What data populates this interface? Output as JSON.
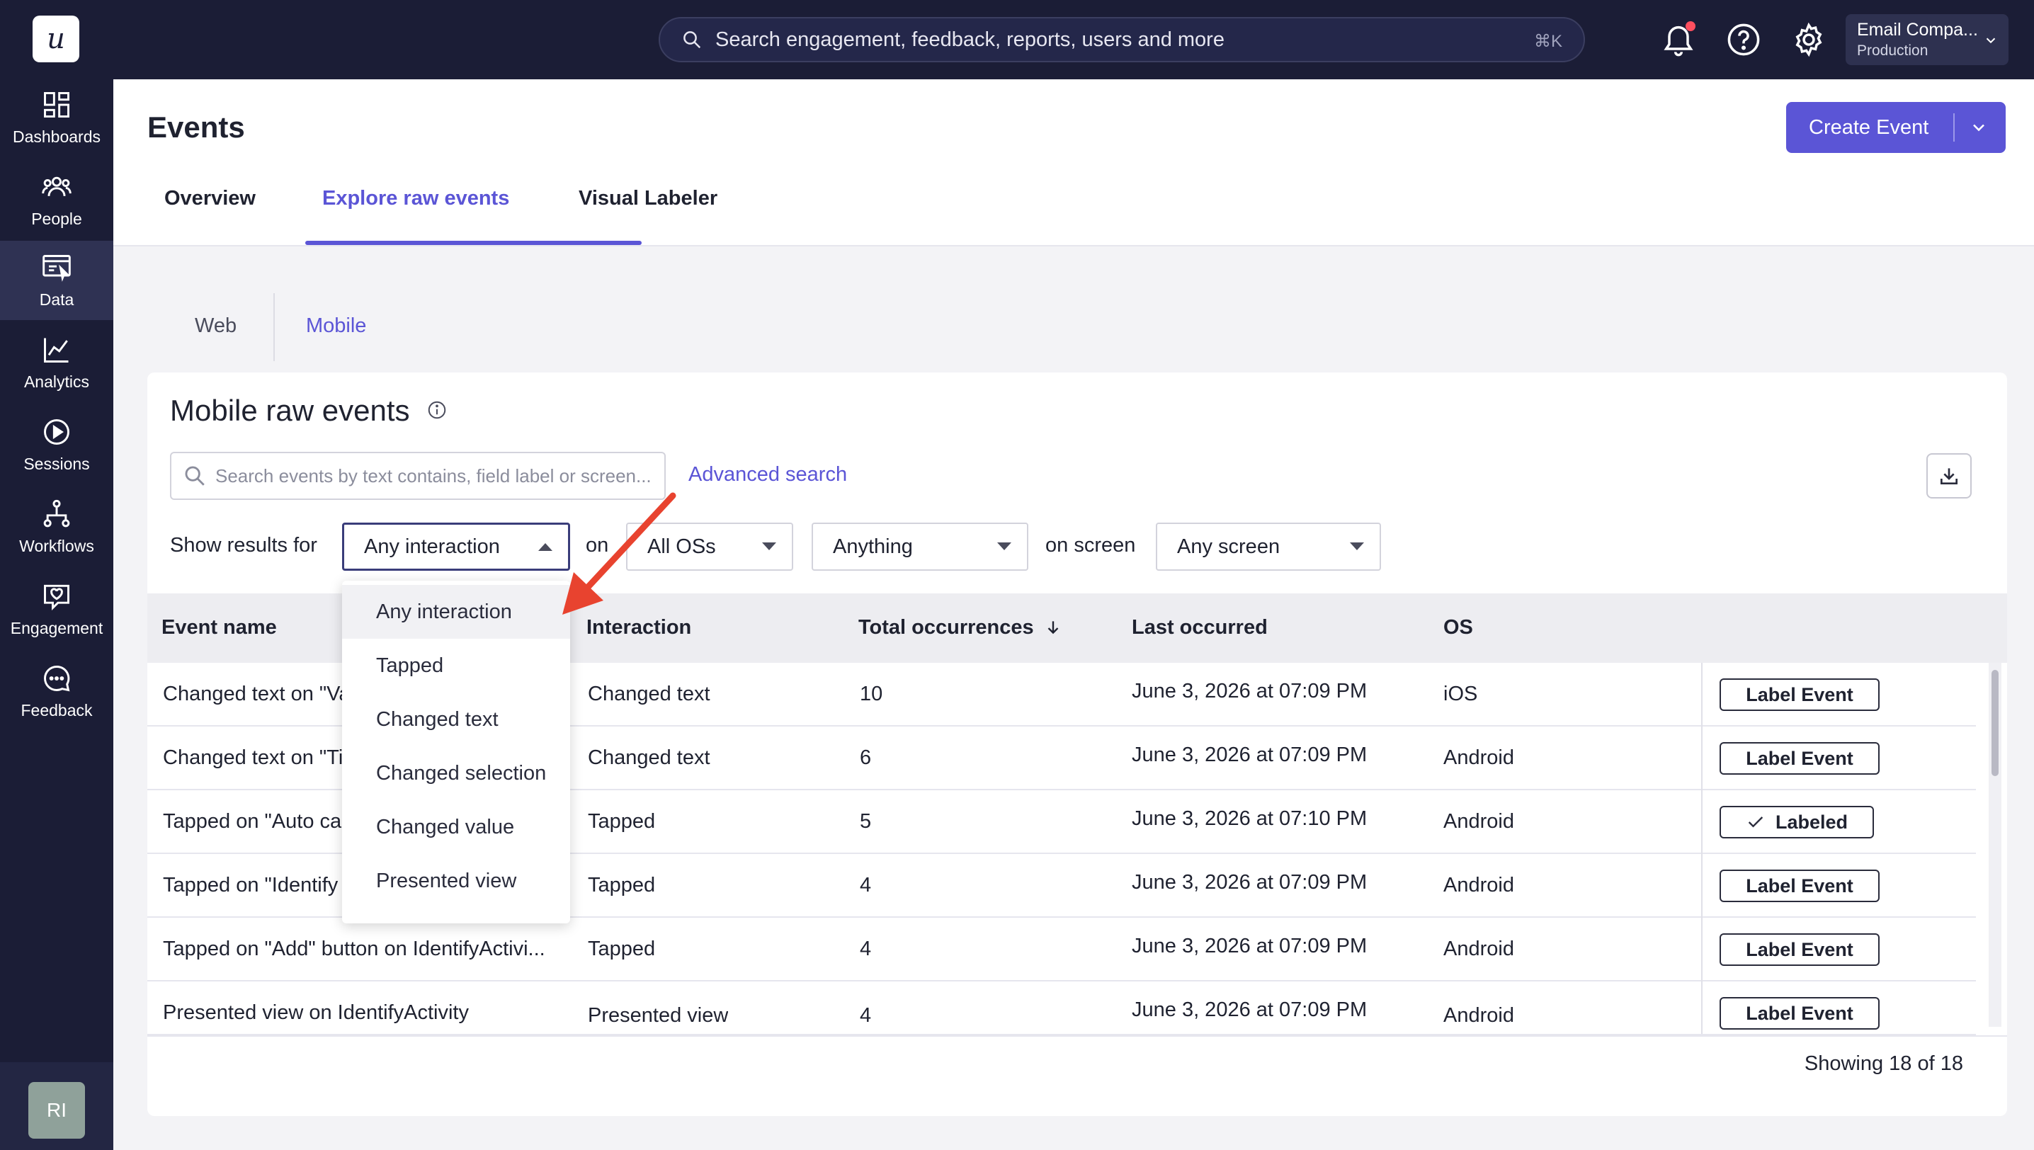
{
  "app": {
    "logo_letter": "u",
    "nav": [
      {
        "label": "Dashboards",
        "icon": "dashboards-icon"
      },
      {
        "label": "People",
        "icon": "people-icon"
      },
      {
        "label": "Data",
        "icon": "data-icon",
        "active": true
      },
      {
        "label": "Analytics",
        "icon": "analytics-icon"
      },
      {
        "label": "Sessions",
        "icon": "sessions-icon"
      },
      {
        "label": "Workflows",
        "icon": "workflows-icon"
      },
      {
        "label": "Engagement",
        "icon": "engagement-icon"
      },
      {
        "label": "Feedback",
        "icon": "feedback-icon"
      }
    ],
    "user_initials": "RI"
  },
  "topbar": {
    "search_placeholder": "Search engagement, feedback, reports, users and more",
    "search_shortcut": "⌘K",
    "account_name": "Email Compa...",
    "account_env": "Production"
  },
  "header": {
    "title": "Events",
    "create_button": "Create Event",
    "tabs": [
      "Overview",
      "Explore raw events",
      "Visual Labeler"
    ],
    "active_tab": "Explore raw events"
  },
  "subtabs": {
    "web": "Web",
    "mobile": "Mobile",
    "active": "Mobile"
  },
  "card": {
    "title": "Mobile raw events",
    "search_placeholder": "Search events by text contains, field label or screen...",
    "advanced_search": "Advanced search",
    "filters": {
      "show_results_label": "Show results for",
      "interaction_value": "Any interaction",
      "on_label": "on",
      "os_value": "All OSs",
      "anything_value": "Anything",
      "on_screen_label": "on screen",
      "screen_value": "Any screen"
    },
    "interaction_options": [
      "Any interaction",
      "Tapped",
      "Changed text",
      "Changed selection",
      "Changed value",
      "Presented view"
    ],
    "columns": [
      "Event name",
      "Interaction",
      "Total occurrences",
      "Last occurred",
      "OS"
    ],
    "rows": [
      {
        "event": "Changed text on \"Va",
        "interaction": "Changed text",
        "count": "10",
        "last": "June 3, 2026 at 07:09 PM",
        "os": "iOS",
        "action": "Label Event",
        "labeled": false
      },
      {
        "event": "Changed text on \"Ti",
        "interaction": "Changed text",
        "count": "6",
        "last": "June 3, 2026 at 07:09 PM",
        "os": "Android",
        "action": "Label Event",
        "labeled": false
      },
      {
        "event": "Tapped on \"Auto ca",
        "interaction": "Tapped",
        "count": "5",
        "last": "June 3, 2026 at 07:10 PM",
        "os": "Android",
        "action": "Labeled",
        "labeled": true
      },
      {
        "event": "Tapped on \"Identify",
        "interaction": "Tapped",
        "count": "4",
        "last": "June 3, 2026 at 07:09 PM",
        "os": "Android",
        "action": "Label Event",
        "labeled": false
      },
      {
        "event": "Tapped on \"Add\" button on IdentifyActivi...",
        "interaction": "Tapped",
        "count": "4",
        "last": "June 3, 2026 at 07:09 PM",
        "os": "Android",
        "action": "Label Event",
        "labeled": false
      },
      {
        "event": "Presented view on IdentifyActivity",
        "interaction": "Presented view",
        "count": "4",
        "last": "June 3, 2026 at 07:09 PM",
        "os": "Android",
        "action": "Label Event",
        "labeled": false
      }
    ],
    "showing": "Showing 18 of 18"
  },
  "colors": {
    "accent": "#5b55d6",
    "nav_bg": "#1b1d36",
    "annotation_arrow": "#e8432f"
  }
}
